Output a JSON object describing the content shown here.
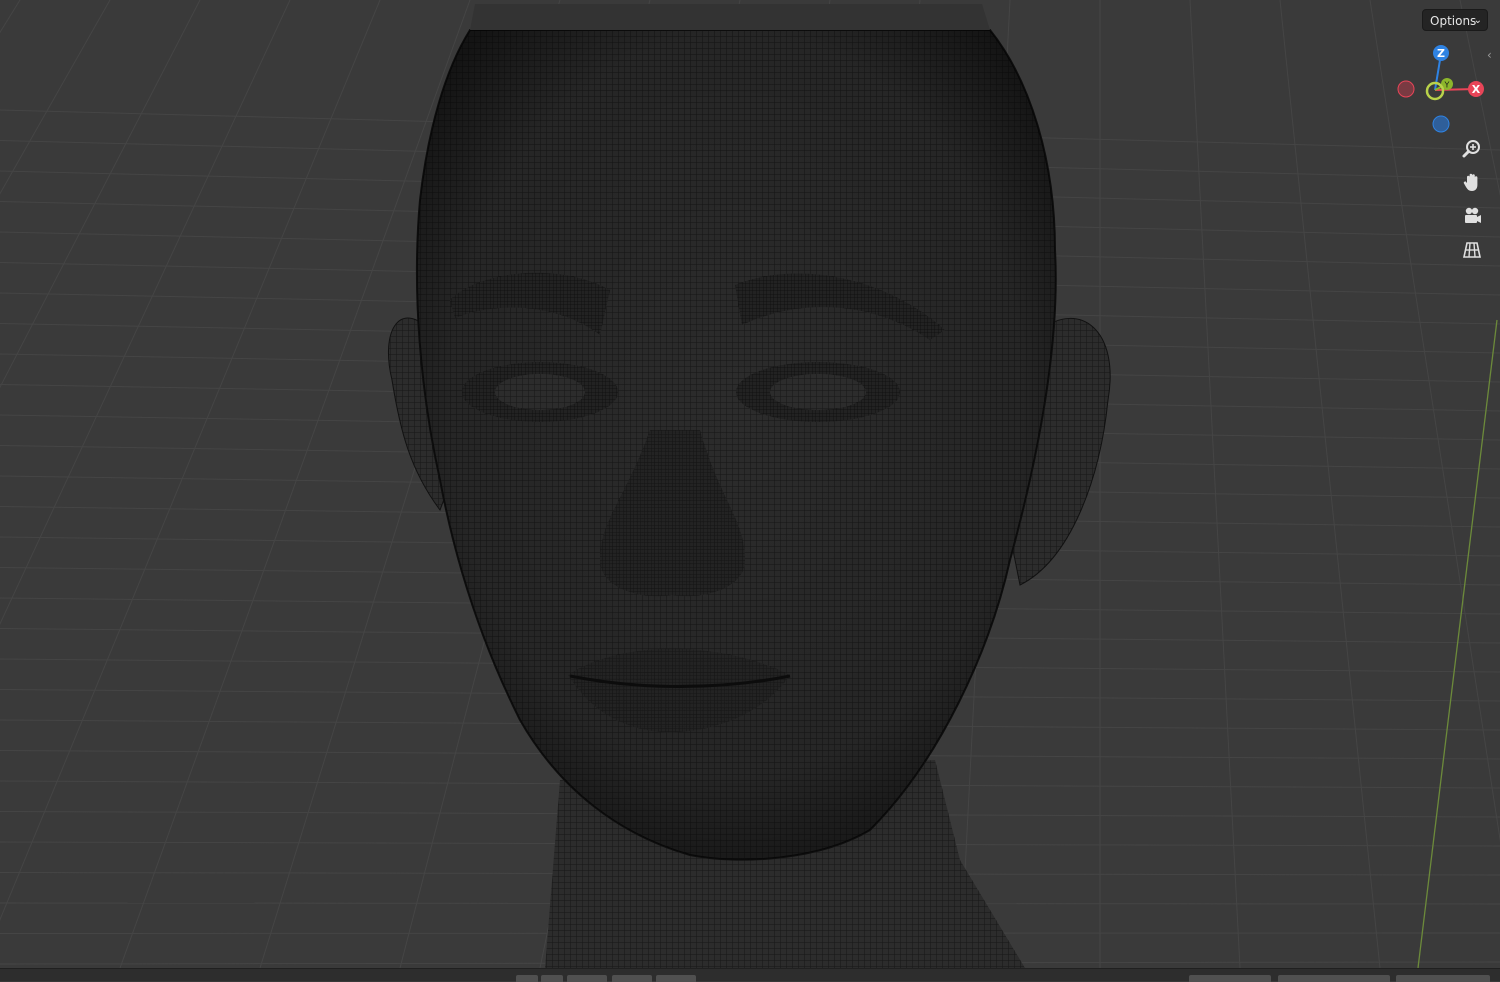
{
  "viewport": {
    "options_label": "Options",
    "gizmo": {
      "z_label": "Z",
      "x_label": "X",
      "y_label": "Y",
      "colors": {
        "x": "#e84558",
        "y": "#8cb62b",
        "z": "#2f83e3"
      }
    },
    "nav_icons": [
      "zoom-icon",
      "pan-hand-icon",
      "camera-icon",
      "grid-ortho-icon"
    ],
    "colors": {
      "background": "#3a3a3a",
      "grid": "#454545",
      "mesh": "#1c1c1c"
    }
  },
  "statusbar": {
    "colors": {
      "background": "#2d2d2d"
    }
  }
}
